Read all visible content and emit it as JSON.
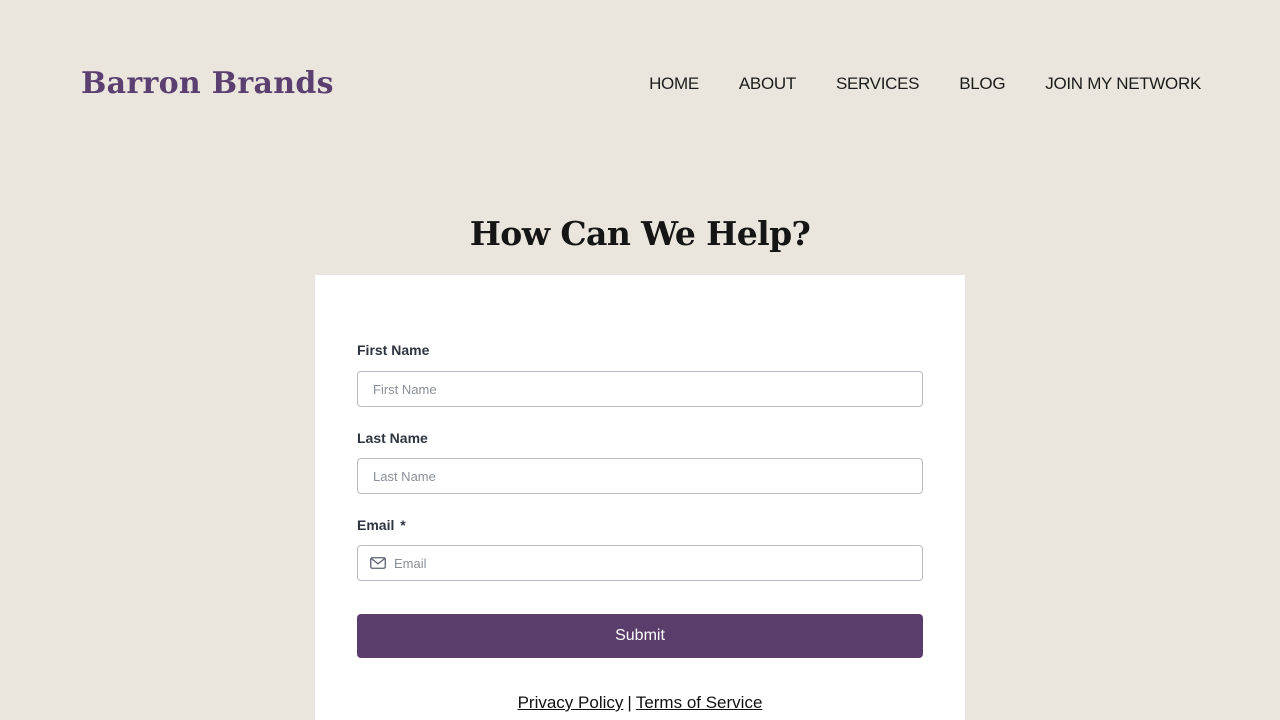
{
  "header": {
    "brand": "Barron Brands",
    "nav": [
      "HOME",
      "ABOUT",
      "SERVICES",
      "BLOG",
      "JOIN MY NETWORK"
    ]
  },
  "main": {
    "heading": "How Can We Help?"
  },
  "form": {
    "first_name": {
      "label": "First Name",
      "placeholder": "First Name",
      "value": ""
    },
    "last_name": {
      "label": "Last Name",
      "placeholder": "Last Name",
      "value": ""
    },
    "email": {
      "label": "Email",
      "required_mark": "*",
      "placeholder": "Email",
      "value": "",
      "icon": "mail-icon"
    },
    "submit_label": "Submit"
  },
  "footer": {
    "privacy": "Privacy Policy",
    "separator": "|",
    "terms": "Terms of Service"
  },
  "colors": {
    "page_background": "#ebe6dd",
    "brand": "#5a3f70",
    "button": "#5b3d6b"
  }
}
